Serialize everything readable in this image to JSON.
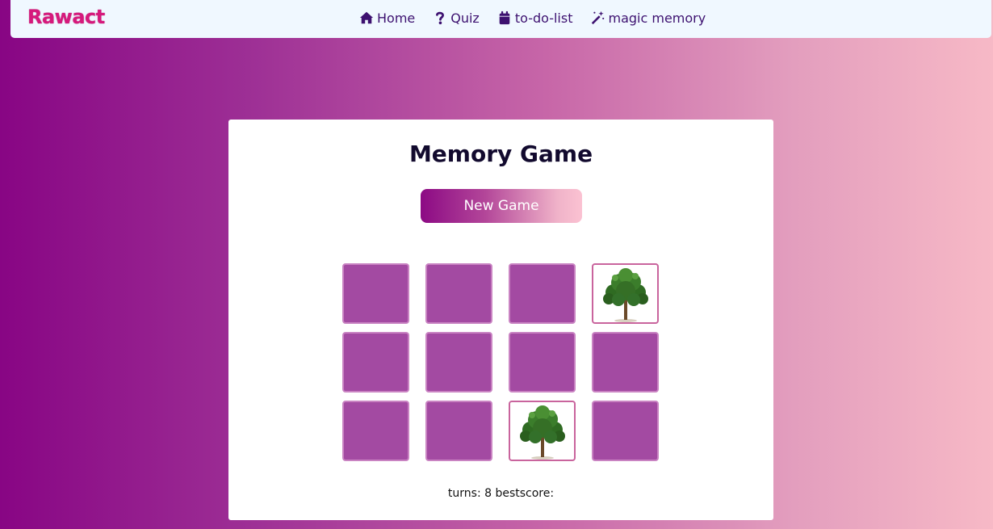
{
  "navbar": {
    "logo": "Rawact",
    "links": [
      {
        "label": "Home",
        "icon": "home-icon"
      },
      {
        "label": "Quiz",
        "icon": "question-icon"
      },
      {
        "label": "to-do-list",
        "icon": "calendar-icon"
      },
      {
        "label": "magic memory",
        "icon": "magic-wand-icon"
      }
    ]
  },
  "game": {
    "title": "Memory Game",
    "new_game_label": "New Game",
    "tiles": [
      {
        "state": "hidden"
      },
      {
        "state": "hidden"
      },
      {
        "state": "hidden"
      },
      {
        "state": "revealed",
        "image": "tree"
      },
      {
        "state": "hidden"
      },
      {
        "state": "hidden"
      },
      {
        "state": "hidden"
      },
      {
        "state": "hidden"
      },
      {
        "state": "hidden"
      },
      {
        "state": "hidden"
      },
      {
        "state": "revealed",
        "image": "tree"
      },
      {
        "state": "hidden"
      }
    ],
    "status_text": "turns: 8 bestscore:"
  },
  "colors": {
    "accent": "#d6197c",
    "nav_text": "#3d1170",
    "tile_back": "#a34aa2"
  }
}
